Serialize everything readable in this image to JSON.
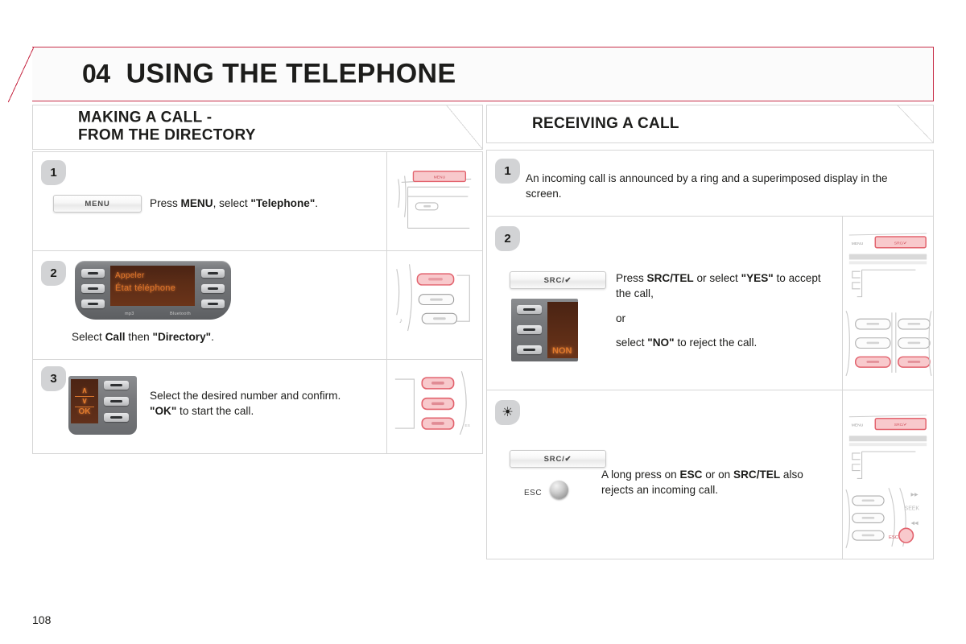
{
  "header": {
    "chapter_number": "04",
    "chapter_title": "USING THE TELEPHONE"
  },
  "sections": {
    "left": {
      "title": "MAKING A CALL -\nFROM THE DIRECTORY"
    },
    "right": {
      "title": "RECEIVING A CALL"
    }
  },
  "left_column": {
    "steps": [
      {
        "badge": "1",
        "button_label": "MENU",
        "text_parts": [
          "Press ",
          "MENU",
          ", select ",
          "\"Telephone\"",
          "."
        ],
        "illustration": "dashboard-menu-button-highlight"
      },
      {
        "badge": "2",
        "text_parts": [
          "Select ",
          "Call",
          " then ",
          "\"Directory\"",
          "."
        ],
        "display": {
          "line1": "Appeler",
          "line2": "État téléphone",
          "logo_left": "mp3",
          "logo_right": "Bluetooth"
        },
        "illustration": "radio-top-button-highlight"
      },
      {
        "badge": "3",
        "text_line1_parts": [
          "Select the desired number and confirm."
        ],
        "text_line2_parts": [
          "\"OK\"",
          " to start the call."
        ],
        "okpanel": {
          "up": "∧",
          "down": "∨",
          "ok": "OK"
        },
        "illustration": "radio-three-buttons-highlight"
      }
    ]
  },
  "right_column": {
    "steps": [
      {
        "badge": "1",
        "text": "An incoming call is announced by a ring and a superimposed display in the screen."
      },
      {
        "badge": "2",
        "button_label": "SRC/✔",
        "text_parts": [
          "Press ",
          "SRC/TEL",
          " or select ",
          "\"YES\"",
          " to accept the call,"
        ],
        "text_or": "or",
        "text_parts2": [
          "select ",
          "\"NO\"",
          " to reject the call."
        ],
        "display": {
          "reject_label": "NON"
        },
        "illustration": {
          "name": "radio-src-tel-highlight",
          "menu_label": "MENU",
          "src_label": "SRC/✔"
        }
      },
      {
        "badge": "☀",
        "badge_icon": "info-sun-icon",
        "button_label": "SRC/✔",
        "esc_label": "ESC",
        "text_parts": [
          "A long press on ",
          "ESC",
          " or on ",
          "SRC/TEL",
          " also rejects an incoming call."
        ],
        "illustration": {
          "name": "radio-esc-highlight",
          "menu_label": "MENU",
          "src_label": "SRC/✔",
          "ff_label": "▶▶",
          "seek_label": "SEEK",
          "rew_label": "◀◀",
          "esc_label": "ESC"
        }
      }
    ]
  },
  "footer": {
    "page_number": "108"
  },
  "colors": {
    "accent_red": "#c8304a",
    "highlight_red": "#e8646e",
    "highlight_fill": "#f8c9cc",
    "badge_grey": "#d2d3d5",
    "screen_orange": "#e1762a",
    "border_grey": "#d6d6d6"
  }
}
